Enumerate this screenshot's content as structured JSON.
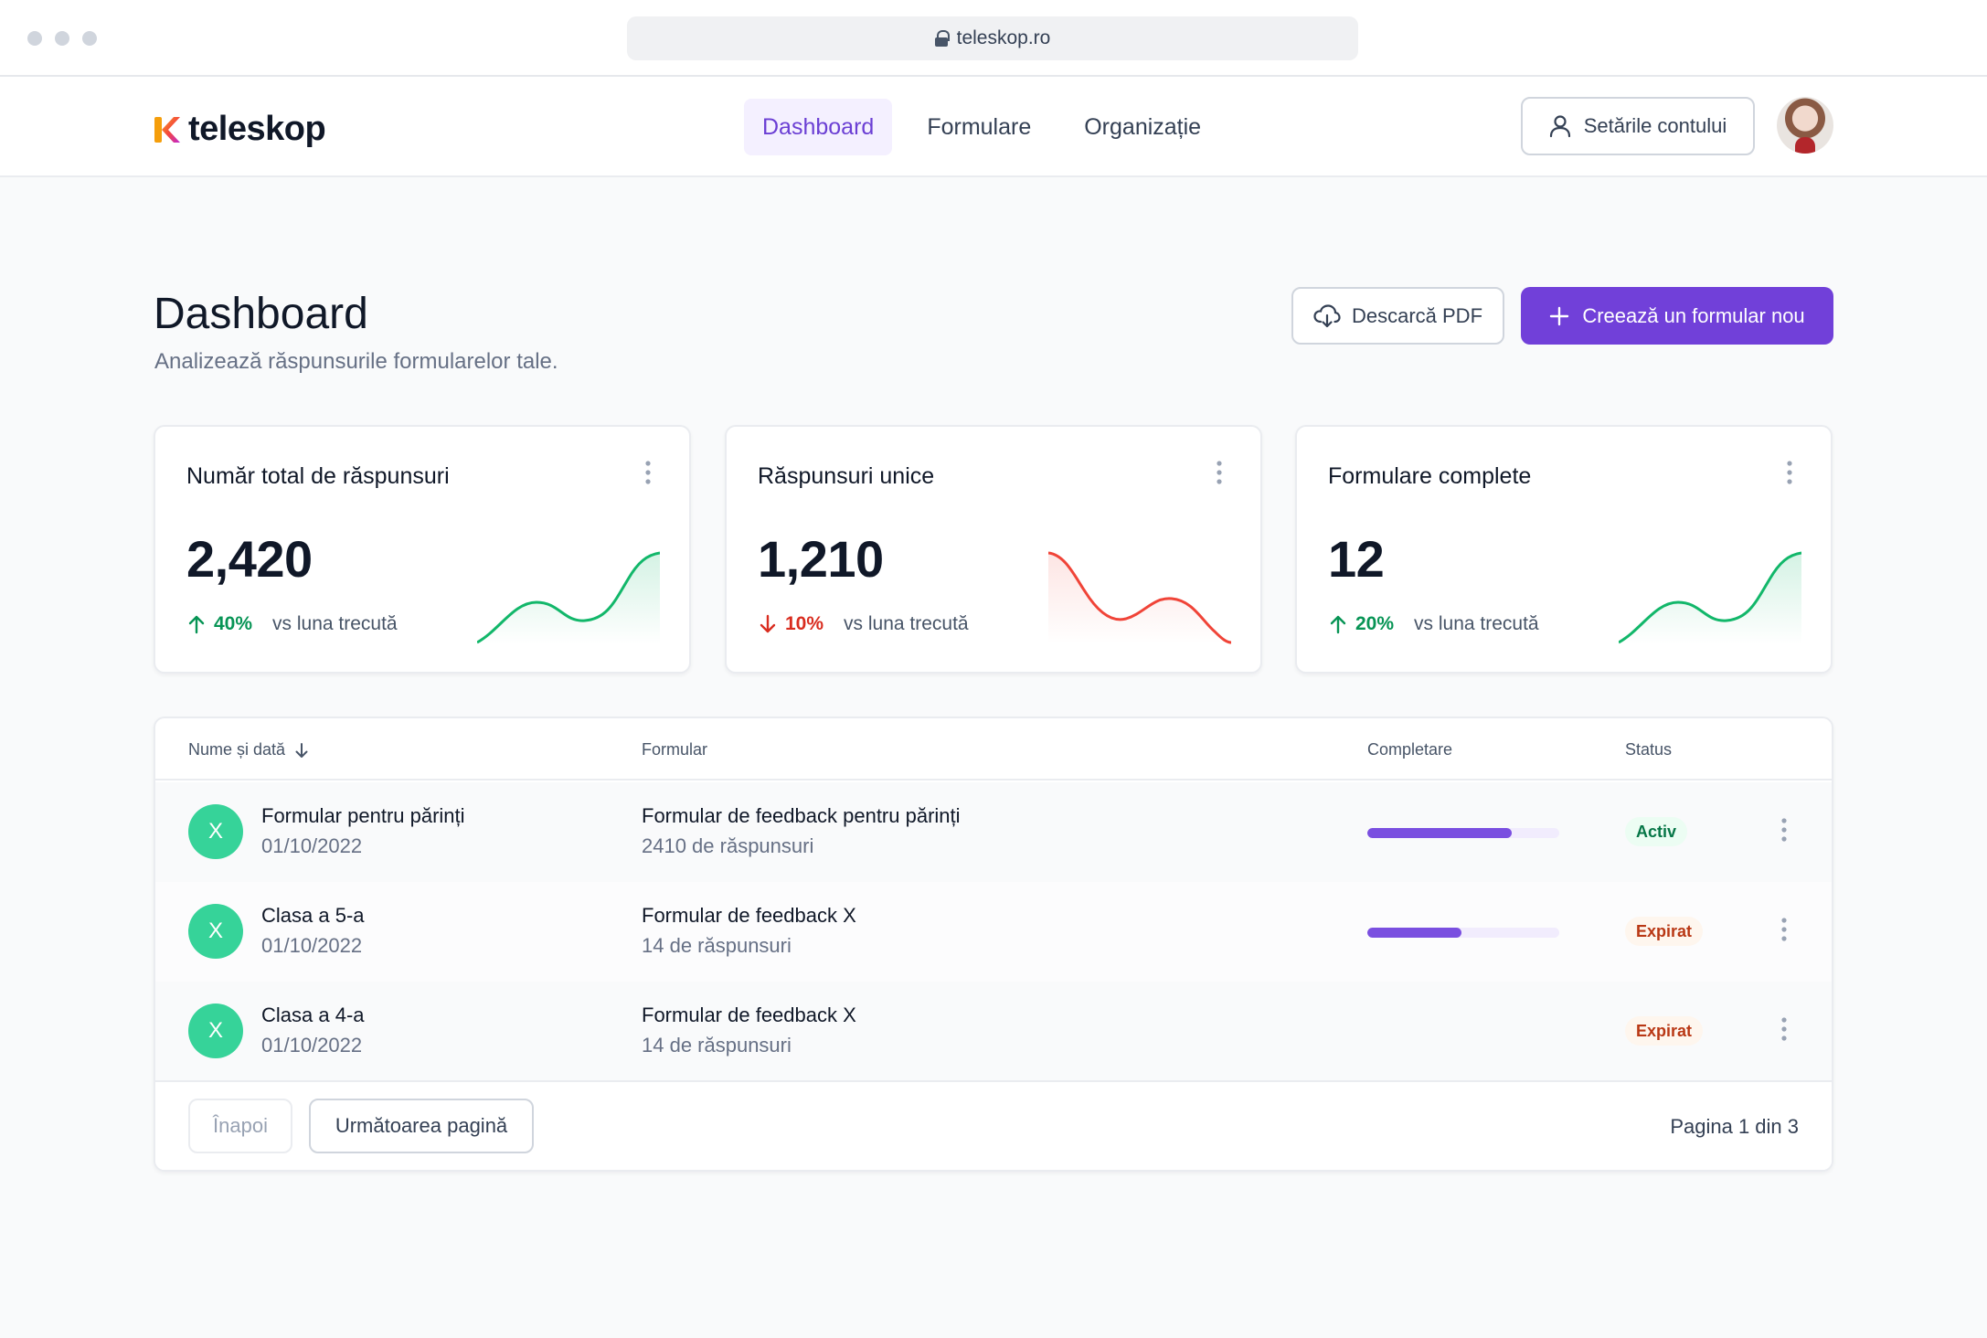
{
  "browser": {
    "url": "teleskop.ro"
  },
  "brand": {
    "name": "teleskop"
  },
  "nav": {
    "items": [
      {
        "label": "Dashboard",
        "active": true
      },
      {
        "label": "Formulare",
        "active": false
      },
      {
        "label": "Organizație",
        "active": false
      }
    ],
    "account_label": "Setările contului"
  },
  "page": {
    "title": "Dashboard",
    "subtitle": "Analizează răspunsurile formularelor tale.",
    "download_label": "Descarcă PDF",
    "create_label": "Creează un formular nou"
  },
  "stats": [
    {
      "title": "Număr total de răspunsuri",
      "value": "2,420",
      "change": "40%",
      "direction": "up",
      "compare": "vs luna trecută"
    },
    {
      "title": "Răspunsuri unice",
      "value": "1,210",
      "change": "10%",
      "direction": "down",
      "compare": "vs luna trecută"
    },
    {
      "title": "Formulare complete",
      "value": "12",
      "change": "20%",
      "direction": "up",
      "compare": "vs luna trecută"
    }
  ],
  "colors": {
    "accent": "#7140d9",
    "positive": "#079455",
    "negative": "#d92d20",
    "avatar": "#36d399"
  },
  "table": {
    "headers": {
      "name": "Nume și dată",
      "form": "Formular",
      "completion": "Completare",
      "status": "Status"
    },
    "rows": [
      {
        "initial": "X",
        "name": "Formular pentru părinți",
        "date": "01/10/2022",
        "form": "Formular de feedback pentru părinți",
        "responses": "2410 de răspunsuri",
        "completion": 0.75,
        "status": "Activ"
      },
      {
        "initial": "X",
        "name": "Clasa a 5-a",
        "date": "01/10/2022",
        "form": "Formular de feedback X",
        "responses": "14 de răspunsuri",
        "completion": 0.49,
        "status": "Expirat"
      },
      {
        "initial": "X",
        "name": "Clasa a 4-a",
        "date": "01/10/2022",
        "form": "Formular de feedback X",
        "responses": "14 de răspunsuri",
        "completion": null,
        "status": "Expirat"
      }
    ],
    "pagination": {
      "prev_label": "Înapoi",
      "next_label": "Următoarea pagină",
      "page_info": "Pagina 1 din 3"
    }
  }
}
